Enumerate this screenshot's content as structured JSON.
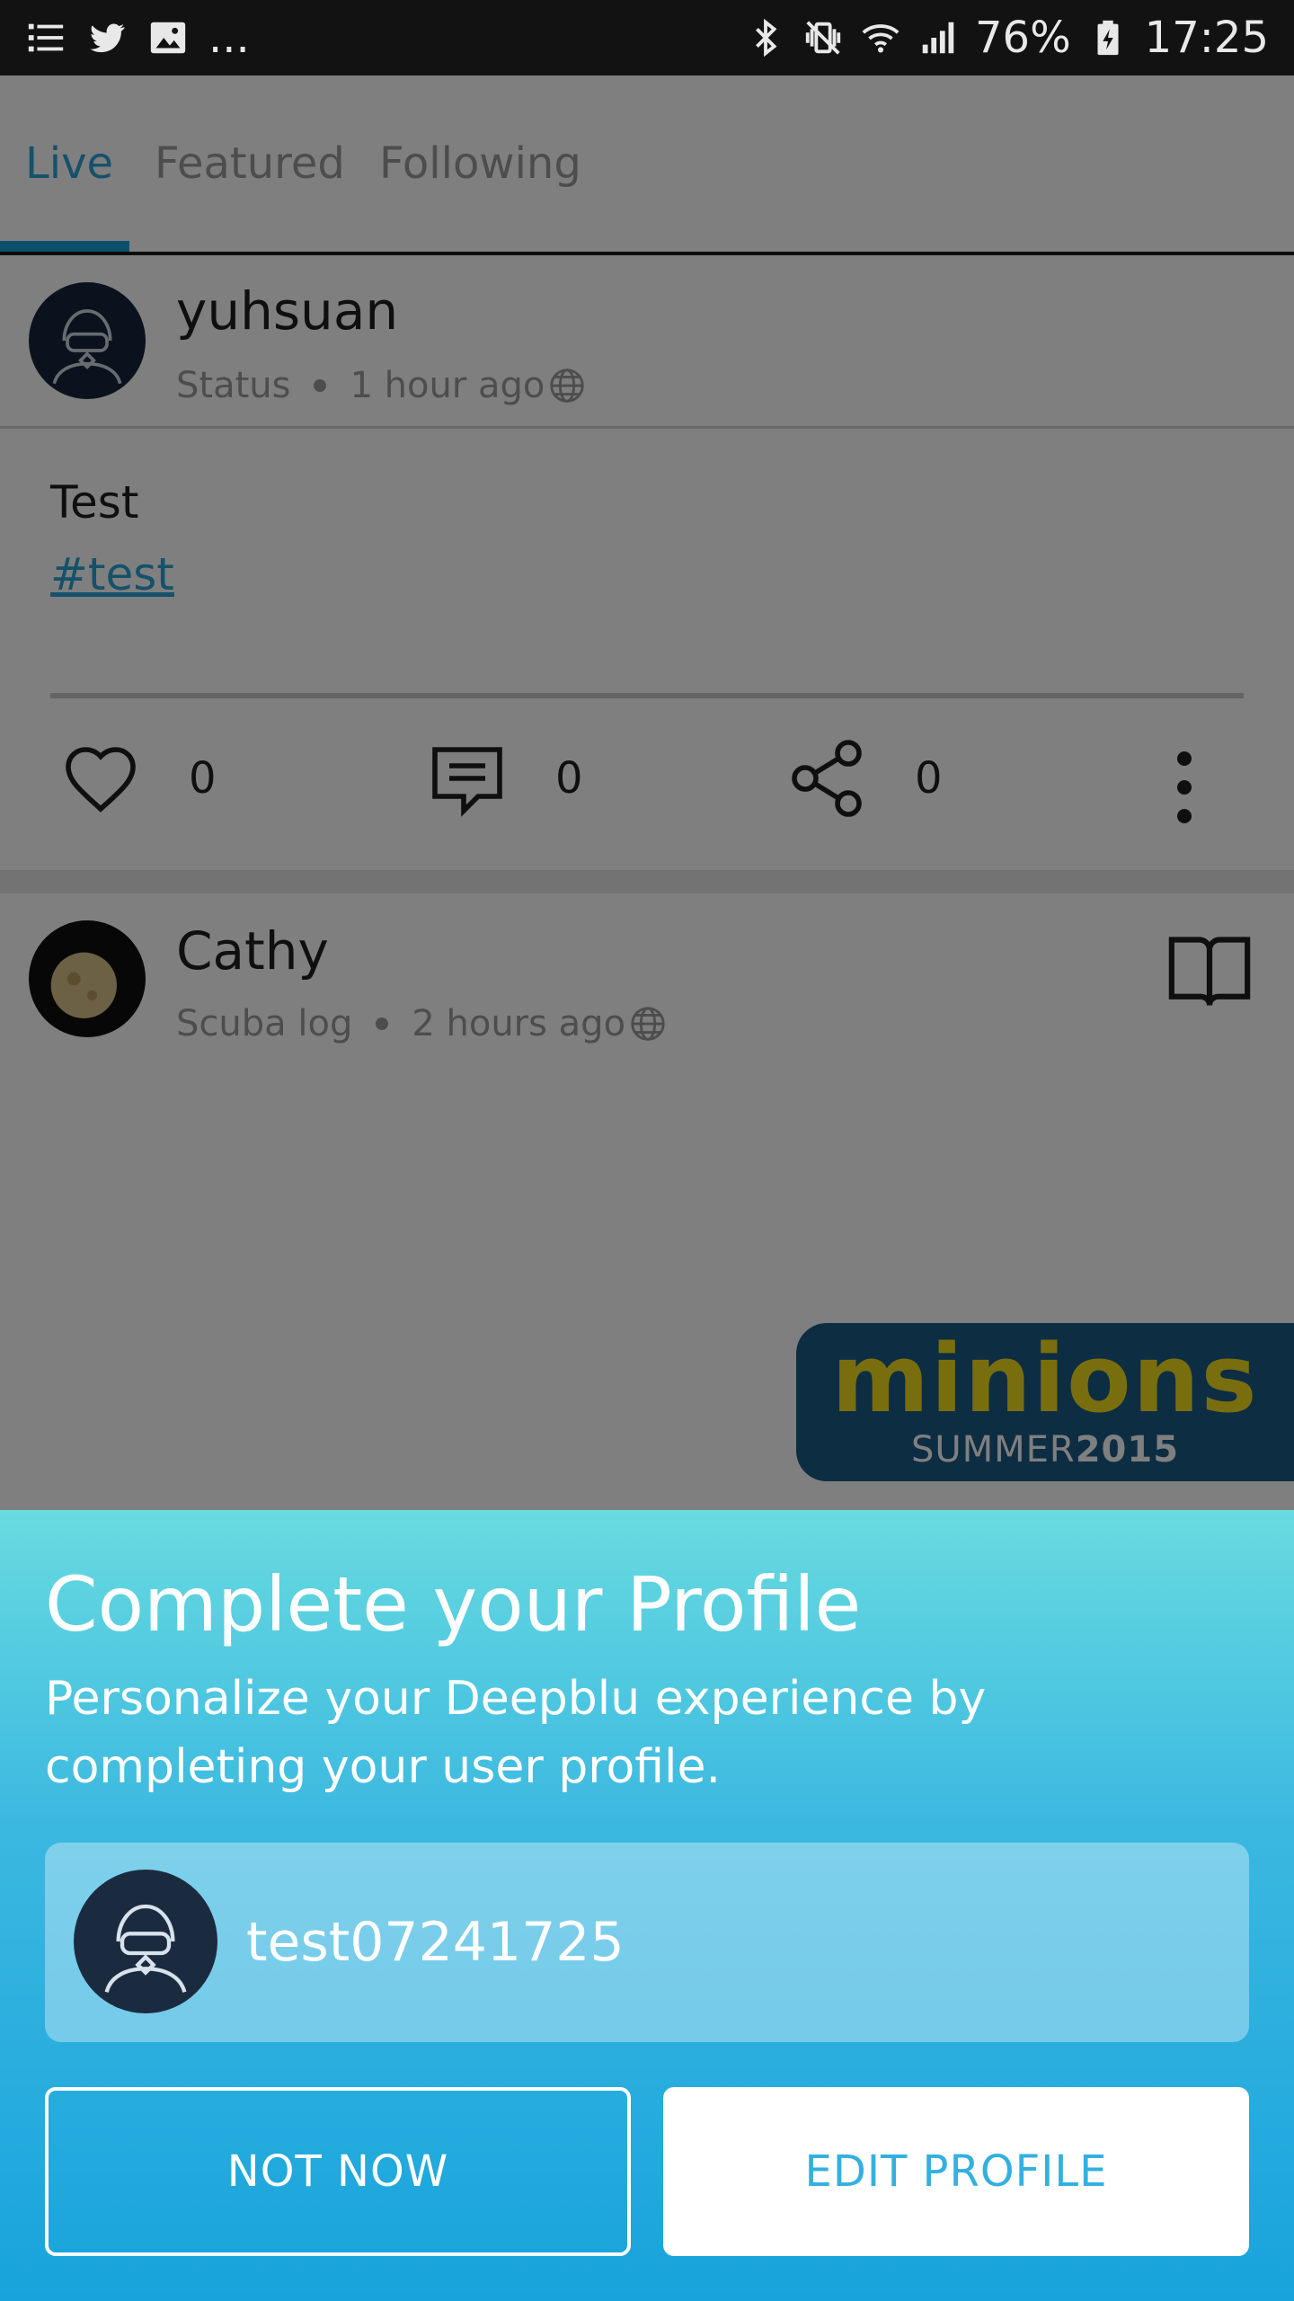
{
  "status_bar": {
    "battery": "76%",
    "time": "17:25",
    "left_icons": [
      "list-icon",
      "twitter-icon",
      "image-icon",
      "more-dots"
    ],
    "more_text": "...",
    "right_icons": [
      "bluetooth-icon",
      "vibrate-icon",
      "wifi-icon",
      "signal-icon",
      "battery-charging-icon"
    ]
  },
  "tabs": [
    {
      "label": "Live",
      "active": true
    },
    {
      "label": "Featured",
      "active": false
    },
    {
      "label": "Following",
      "active": false
    }
  ],
  "posts": [
    {
      "username": "yuhsuan",
      "type": "Status",
      "time": "1 hour ago",
      "body": "Test",
      "hashtag": "#test",
      "likes": "0",
      "comments": "0",
      "shares": "0"
    },
    {
      "username": "Cathy",
      "type": "Scuba log",
      "time": "2 hours ago",
      "banner_title": "minions",
      "banner_sub_plain": "SUMMER",
      "banner_sub_bold": "2015"
    }
  ],
  "sheet": {
    "title": "Complete your Profile",
    "description": "Personalize your Deepblu experience by completing your user profile.",
    "profile_name": "test07241725",
    "not_now_label": "NOT NOW",
    "edit_label": "EDIT PROFILE"
  },
  "colors": {
    "accent": "#1aa1d8",
    "sheet_top": "#68dbe0",
    "sheet_bottom": "#18a3dc",
    "banner_bg": "#1b5a86",
    "banner_title": "#f2dd1c"
  }
}
